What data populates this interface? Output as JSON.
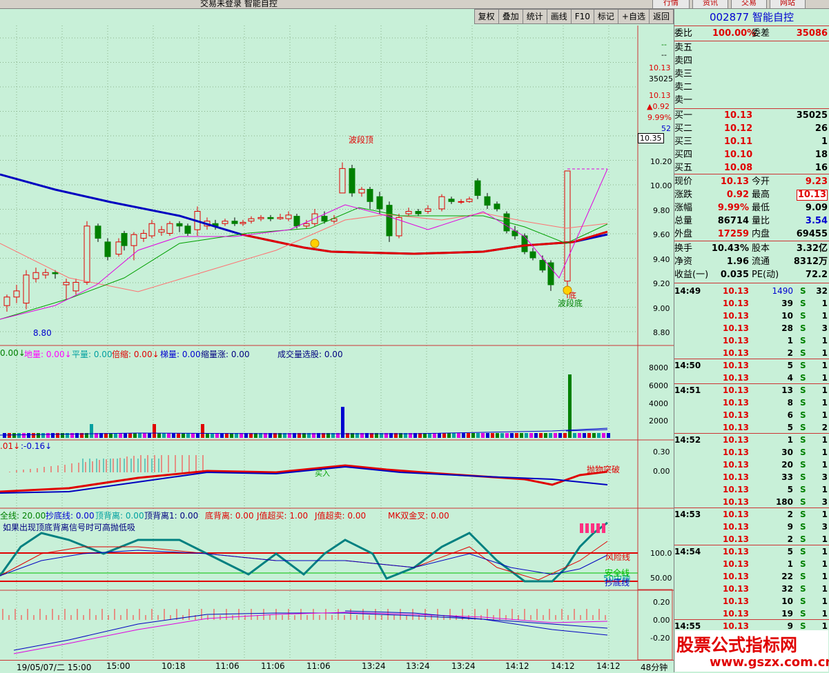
{
  "titlebar": {
    "title": "交易未登录  智能自控",
    "btns": [
      "行情",
      "资讯",
      "交易",
      "网站"
    ]
  },
  "toolbar": [
    "复权",
    "叠加",
    "统计",
    "画线",
    "F10",
    "标记",
    "+自选",
    "返回"
  ],
  "price_axis": [
    "10.35",
    "10.20",
    "10.00",
    "9.80",
    "9.60",
    "9.40",
    "9.20",
    "9.00",
    "8.80"
  ],
  "mini_info": [
    "--",
    "--",
    "10.13",
    "35025",
    "10.13",
    "▲0.92",
    "9.99%",
    "52"
  ],
  "annotations": {
    "peak": "波段顶",
    "bottom": "波段底",
    "low": "8.80",
    "bei": "倍",
    "buy": "买入",
    "bottom_char": "底"
  },
  "vol_header": {
    "a": "0.00↓",
    "b": "地量: 0.00↓",
    "c": "平量: 0.00",
    "d": "倍缩: 0.00↓",
    "e": "梯量: 0.00",
    "f": "缩量涨: 0.00",
    "g": "成交量选股: 0.00"
  },
  "vol_axis": [
    "8000",
    "6000",
    "4000",
    "2000"
  ],
  "macd_header": {
    "a": ".01↓",
    "b": ":-0.16↓"
  },
  "macd_axis": [
    "0.30",
    "0.00"
  ],
  "macd_note": "抛物突破",
  "kdj_header": {
    "a": "全线: 20.00",
    "b": "抄底线: 0.00",
    "c": "顶背离: 0.00",
    "d": "顶背离1: 0.00",
    "e": "底背离: 0.00",
    "f": "J值超买: 1.00",
    "g": "J值超卖: 0.00",
    "h": "MK双金叉: 0.00"
  },
  "kdj_note": "如果出现顶底背离信号时可高抛低吸",
  "kdj_axis": [
    "100.0",
    "50.00"
  ],
  "kdj_lines": {
    "risk": "风险线",
    "mid": "50中轴",
    "safe": "安全线",
    "bottom": "抄底线"
  },
  "last_axis": [
    "0.20",
    "0.00",
    "-0.20"
  ],
  "time_axis": [
    "19/05/07/二 15:00",
    "15:00",
    "10:18",
    "11:06",
    "11:06",
    "11:06",
    "13:24",
    "13:24",
    "13:24",
    "14:12",
    "14:12",
    "14:12",
    "48分钟"
  ],
  "stock": {
    "code": "002877",
    "name": "智能自控"
  },
  "weibi": {
    "label": "委比",
    "value": "100.00%",
    "label2": "委差",
    "value2": "35086"
  },
  "sells": [
    {
      "l": "卖五"
    },
    {
      "l": "卖四"
    },
    {
      "l": "卖三"
    },
    {
      "l": "卖二"
    },
    {
      "l": "卖一"
    }
  ],
  "buys": [
    {
      "l": "买一",
      "p": "10.13",
      "v": "35025"
    },
    {
      "l": "买二",
      "p": "10.12",
      "v": "26"
    },
    {
      "l": "买三",
      "p": "10.11",
      "v": "1"
    },
    {
      "l": "买四",
      "p": "10.10",
      "v": "18"
    },
    {
      "l": "买五",
      "p": "10.08",
      "v": "16"
    }
  ],
  "quote": [
    {
      "l": "现价",
      "v": "10.13",
      "l2": "今开",
      "v2": "9.23"
    },
    {
      "l": "涨跌",
      "v": "0.92",
      "l2": "最高",
      "v2": "10.13"
    },
    {
      "l": "涨幅",
      "v": "9.99%",
      "l2": "最低",
      "v2": "9.09"
    },
    {
      "l": "总量",
      "v": "86714",
      "l2": "量比",
      "v2": "3.54"
    },
    {
      "l": "外盘",
      "v": "17259",
      "l2": "内盘",
      "v2": "69455"
    }
  ],
  "fin": [
    {
      "l": "换手",
      "v": "10.43%",
      "l2": "股本",
      "v2": "3.32亿"
    },
    {
      "l": "净资",
      "v": "1.96",
      "l2": "流通",
      "v2": "8312万"
    },
    {
      "l": "收益(一)",
      "v": "0.035",
      "l2": "PE(动)",
      "v2": "72.2"
    }
  ],
  "ticks": [
    {
      "t": "14:49",
      "p": "10.13",
      "v": "1490",
      "s": "S",
      "n": "32"
    },
    {
      "t": "",
      "p": "10.13",
      "v": "39",
      "s": "S",
      "n": "1"
    },
    {
      "t": "",
      "p": "10.13",
      "v": "10",
      "s": "S",
      "n": "1"
    },
    {
      "t": "",
      "p": "10.13",
      "v": "28",
      "s": "S",
      "n": "3"
    },
    {
      "t": "",
      "p": "10.13",
      "v": "1",
      "s": "S",
      "n": "1"
    },
    {
      "t": "",
      "p": "10.13",
      "v": "2",
      "s": "S",
      "n": "1"
    },
    {
      "t": "14:50",
      "p": "10.13",
      "v": "5",
      "s": "S",
      "n": "1"
    },
    {
      "t": "",
      "p": "10.13",
      "v": "4",
      "s": "S",
      "n": "1"
    },
    {
      "t": "14:51",
      "p": "10.13",
      "v": "13",
      "s": "S",
      "n": "1"
    },
    {
      "t": "",
      "p": "10.13",
      "v": "8",
      "s": "S",
      "n": "1"
    },
    {
      "t": "",
      "p": "10.13",
      "v": "6",
      "s": "S",
      "n": "1"
    },
    {
      "t": "",
      "p": "10.13",
      "v": "5",
      "s": "S",
      "n": "2"
    },
    {
      "t": "14:52",
      "p": "10.13",
      "v": "1",
      "s": "S",
      "n": "1"
    },
    {
      "t": "",
      "p": "10.13",
      "v": "30",
      "s": "S",
      "n": "1"
    },
    {
      "t": "",
      "p": "10.13",
      "v": "20",
      "s": "S",
      "n": "1"
    },
    {
      "t": "",
      "p": "10.13",
      "v": "33",
      "s": "S",
      "n": "3"
    },
    {
      "t": "",
      "p": "10.13",
      "v": "5",
      "s": "S",
      "n": "1"
    },
    {
      "t": "",
      "p": "10.13",
      "v": "180",
      "s": "S",
      "n": "3"
    },
    {
      "t": "14:53",
      "p": "10.13",
      "v": "2",
      "s": "S",
      "n": "1"
    },
    {
      "t": "",
      "p": "10.13",
      "v": "9",
      "s": "S",
      "n": "3"
    },
    {
      "t": "",
      "p": "10.13",
      "v": "2",
      "s": "S",
      "n": "1"
    },
    {
      "t": "14:54",
      "p": "10.13",
      "v": "5",
      "s": "S",
      "n": "1"
    },
    {
      "t": "",
      "p": "10.13",
      "v": "1",
      "s": "S",
      "n": "1"
    },
    {
      "t": "",
      "p": "10.13",
      "v": "22",
      "s": "S",
      "n": "1"
    },
    {
      "t": "",
      "p": "10.13",
      "v": "32",
      "s": "S",
      "n": "1"
    },
    {
      "t": "",
      "p": "10.13",
      "v": "10",
      "s": "S",
      "n": "1"
    },
    {
      "t": "",
      "p": "10.13",
      "v": "19",
      "s": "S",
      "n": "1"
    },
    {
      "t": "14:55",
      "p": "10.13",
      "v": "9",
      "s": "S",
      "n": "1"
    }
  ],
  "watermark": {
    "line1": "股票公式指标网",
    "line2": "www.gszx.com.cn"
  }
}
